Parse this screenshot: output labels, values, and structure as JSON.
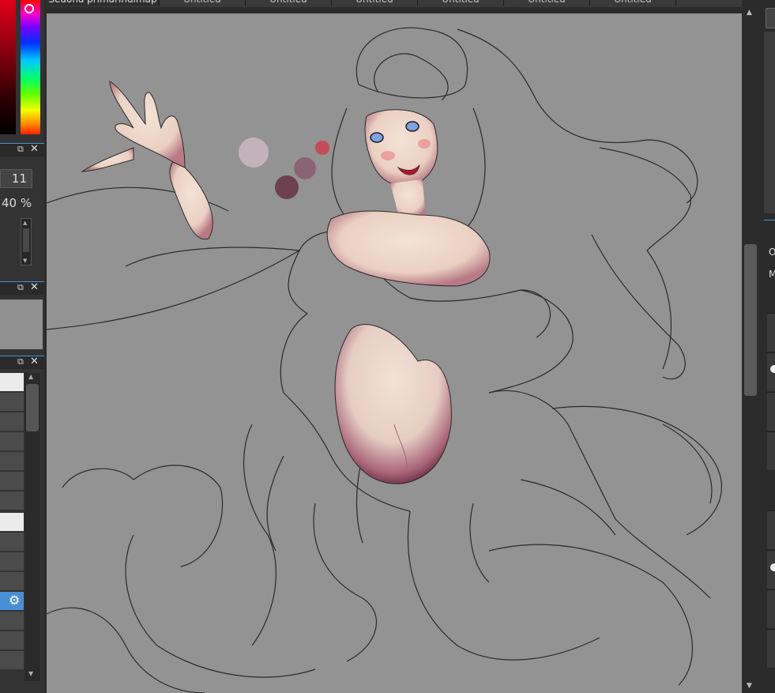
{
  "tabs": [
    {
      "label": "Sedona primarindimap",
      "active": true
    },
    {
      "label": "Untitled",
      "active": false
    },
    {
      "label": "Untitled",
      "active": false
    },
    {
      "label": "Untitled",
      "active": false
    },
    {
      "label": "Untitled",
      "active": false
    },
    {
      "label": "Untitled",
      "active": false
    },
    {
      "label": "Untitled",
      "active": false
    }
  ],
  "left_dock": {
    "brush_size": "11",
    "opacity": "40 %",
    "panel_controls": {
      "popout_icon": "popout-icon",
      "close_icon": "close-icon"
    },
    "color_picker": {
      "current_hue": "#ff0000"
    },
    "selected_layer_icon": "gear-icon"
  },
  "right_dock": {
    "label_1": "O",
    "label_2": "M"
  },
  "palette_swatches": [
    "#c4b2bb",
    "#c44b58",
    "#8a6474",
    "#6e4150"
  ],
  "canvas": {
    "background": "#939393"
  }
}
